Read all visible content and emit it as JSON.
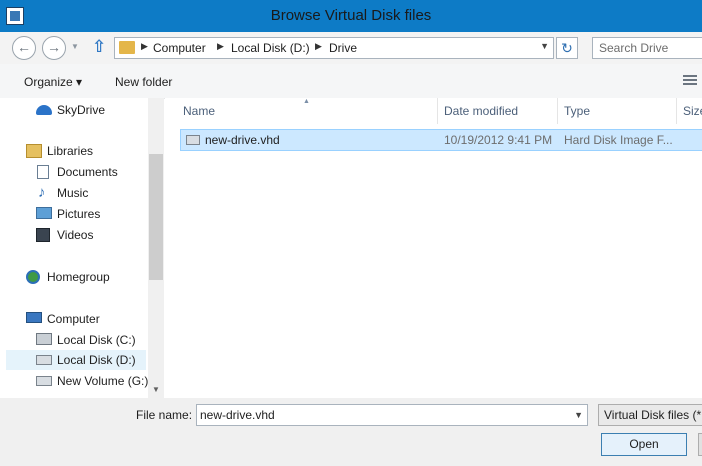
{
  "window": {
    "title": "Browse Virtual Disk files"
  },
  "address": {
    "crumbs": [
      "Computer",
      "Local Disk (D:)",
      "Drive"
    ],
    "search_placeholder": "Search Drive"
  },
  "toolbar": {
    "organize": "Organize ▾",
    "new_folder": "New folder"
  },
  "nav": {
    "skydrive": "SkyDrive",
    "libraries": "Libraries",
    "documents": "Documents",
    "music": "Music",
    "pictures": "Pictures",
    "videos": "Videos",
    "homegroup": "Homegroup",
    "computer": "Computer",
    "local_c": "Local Disk (C:)",
    "local_d": "Local Disk (D:)",
    "new_volume": "New Volume (G:)"
  },
  "columns": {
    "name": "Name",
    "date": "Date modified",
    "type": "Type",
    "size": "Size"
  },
  "files": [
    {
      "name": "new-drive.vhd",
      "date": "10/19/2012 9:41 PM",
      "type": "Hard Disk Image F...",
      "size": ""
    }
  ],
  "bottom": {
    "file_name_label": "File name:",
    "file_name_value": "new-drive.vhd",
    "filter": "Virtual Disk files (*.vhd)",
    "open_label": "Open"
  },
  "colors": {
    "titlebar": "#0d7bc6",
    "selection": "#cce8ff",
    "selection_border": "#99d1ff"
  }
}
